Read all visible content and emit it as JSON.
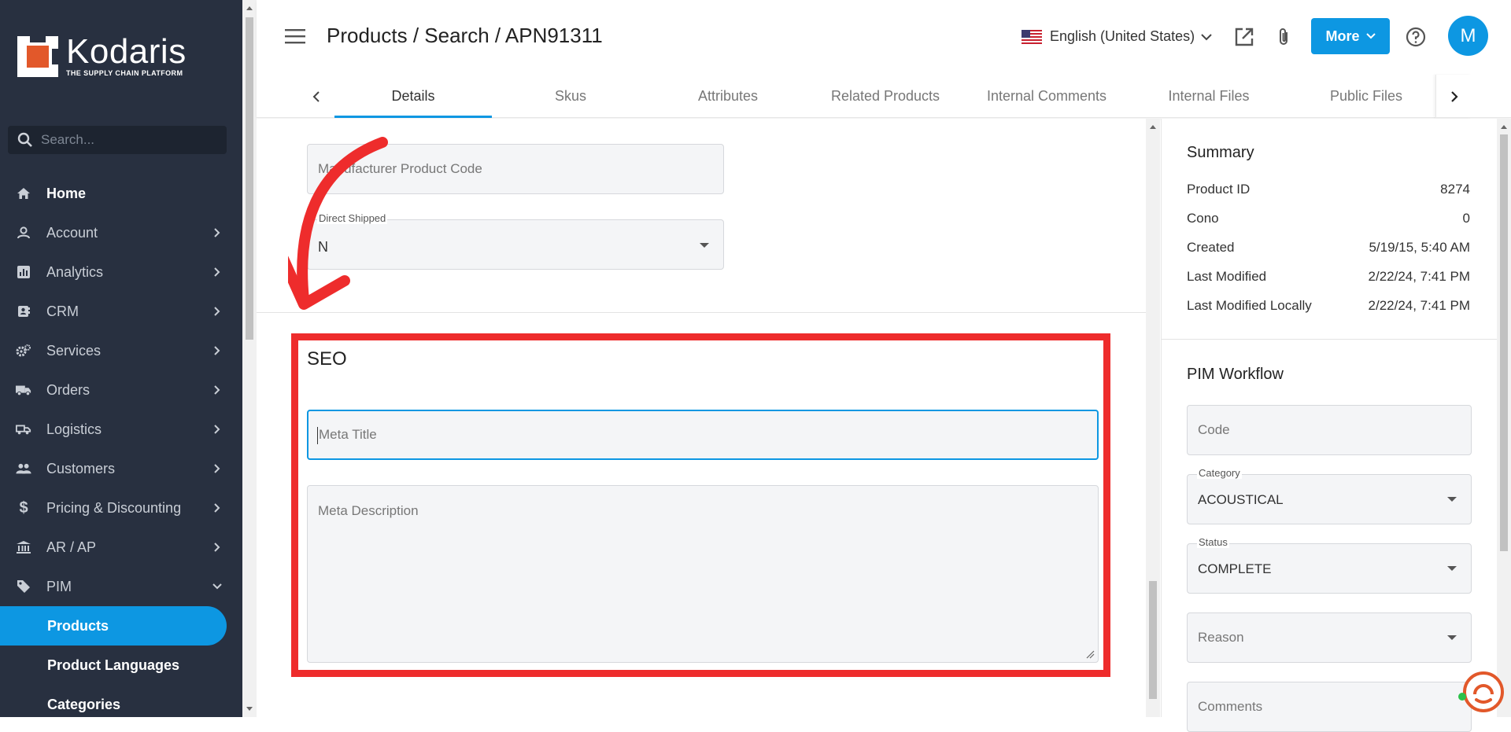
{
  "sidebar": {
    "logo_name": "Kodaris",
    "logo_tagline": "THE SUPPLY CHAIN PLATFORM",
    "search_placeholder": "Search...",
    "items": [
      {
        "label": "Home",
        "icon": "home-icon"
      },
      {
        "label": "Account",
        "icon": "account-icon"
      },
      {
        "label": "Analytics",
        "icon": "analytics-icon"
      },
      {
        "label": "CRM",
        "icon": "crm-icon"
      },
      {
        "label": "Services",
        "icon": "services-icon"
      },
      {
        "label": "Orders",
        "icon": "truck-icon"
      },
      {
        "label": "Logistics",
        "icon": "logistics-icon"
      },
      {
        "label": "Customers",
        "icon": "customers-icon"
      },
      {
        "label": "Pricing & Discounting",
        "icon": "dollar-icon"
      },
      {
        "label": "AR / AP",
        "icon": "bank-icon"
      },
      {
        "label": "PIM",
        "icon": "tag-icon"
      }
    ],
    "sub_items": [
      {
        "label": "Products"
      },
      {
        "label": "Product Languages"
      },
      {
        "label": "Categories"
      }
    ]
  },
  "header": {
    "breadcrumb": "Products / Search / APN91311",
    "language": "English (United States)",
    "more_label": "More",
    "avatar_initial": "M"
  },
  "tabs": [
    {
      "label": "Details"
    },
    {
      "label": "Skus"
    },
    {
      "label": "Attributes"
    },
    {
      "label": "Related Products"
    },
    {
      "label": "Internal Comments"
    },
    {
      "label": "Internal Files"
    },
    {
      "label": "Public Files"
    }
  ],
  "form": {
    "manufacturer_code_placeholder": "Manufacturer Product Code",
    "direct_shipped_label": "Direct Shipped",
    "direct_shipped_value": "N",
    "seo_heading": "SEO",
    "meta_title_placeholder": "Meta Title",
    "meta_description_placeholder": "Meta Description"
  },
  "summary": {
    "title": "Summary",
    "rows": [
      {
        "key": "Product ID",
        "value": "8274"
      },
      {
        "key": "Cono",
        "value": "0"
      },
      {
        "key": "Created",
        "value": "5/19/15, 5:40 AM"
      },
      {
        "key": "Last Modified",
        "value": "2/22/24, 7:41 PM"
      },
      {
        "key": "Last Modified Locally",
        "value": "2/22/24, 7:41 PM"
      }
    ]
  },
  "workflow": {
    "title": "PIM Workflow",
    "code_placeholder": "Code",
    "category_label": "Category",
    "category_value": "ACOUSTICAL",
    "status_label": "Status",
    "status_value": "COMPLETE",
    "reason_placeholder": "Reason",
    "comments_placeholder": "Comments"
  },
  "colors": {
    "accent": "#0d97e2",
    "sidebar_bg": "#283040",
    "highlight": "#ee2c2c",
    "logo_orange": "#e2582a"
  }
}
